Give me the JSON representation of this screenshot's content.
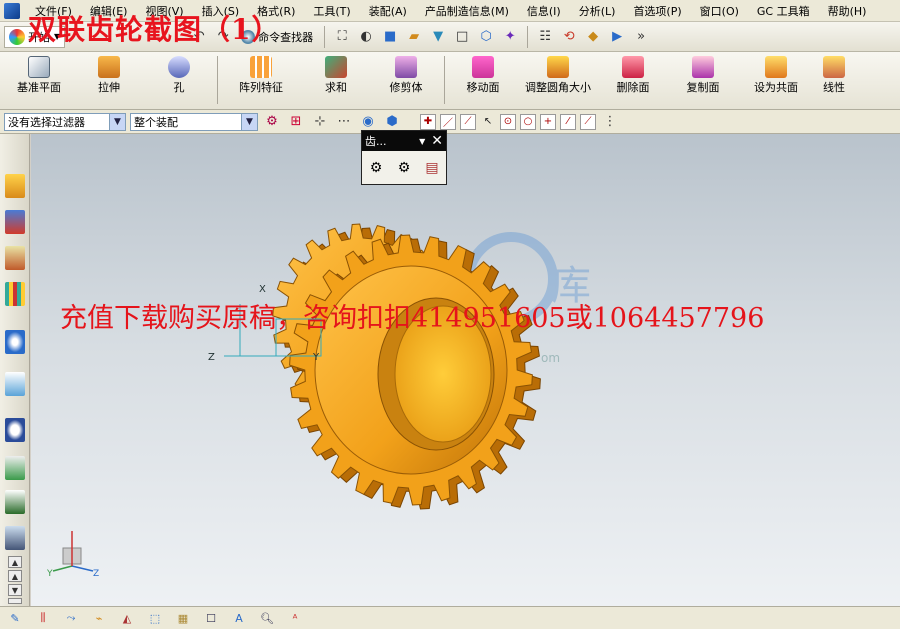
{
  "menubar": {
    "items": [
      "文件(F)",
      "编辑(E)",
      "视图(V)",
      "插入(S)",
      "格式(R)",
      "工具(T)",
      "装配(A)",
      "产品制造信息(M)",
      "信息(I)",
      "分析(L)",
      "首选项(P)",
      "窗口(O)",
      "GC 工具箱",
      "帮助(H)"
    ]
  },
  "toolbar_standard": {
    "start_label": "开始",
    "command_finder": "命令查找器"
  },
  "toolbar_feature": {
    "buttons": [
      "基准平面",
      "拉伸",
      "孔",
      "阵列特征",
      "求和",
      "修剪体",
      "移动面",
      "调整圆角大小",
      "删除面",
      "复制面",
      "设为共面",
      "线性"
    ]
  },
  "toolbar_filter": {
    "type_filter": "没有选择过滤器",
    "scope": "整个装配"
  },
  "gear_toolbar": {
    "title": "齿..."
  },
  "overlay": {
    "title": "双联齿轮截图（1）",
    "promo": "充值下载购买原稿，咨询扣扣414951605或1064457796",
    "logo_url_fragment": "om"
  },
  "axes": {
    "x": "X",
    "y": "Y",
    "z": "Z"
  },
  "colors": {
    "gear_main": "#f2a11a",
    "gear_dark": "#b96d06",
    "accent_red": "#e8141e"
  }
}
